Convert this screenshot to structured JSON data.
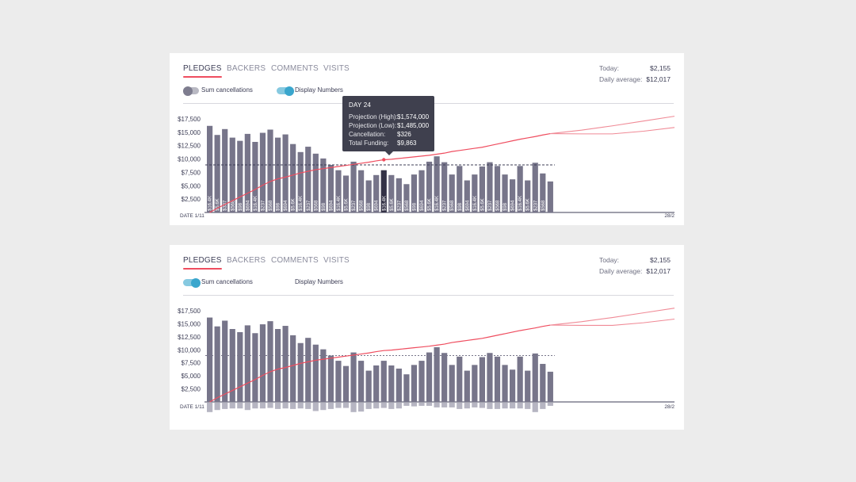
{
  "tabs": [
    "PLEDGES",
    "BACKERS",
    "COMMENTS",
    "VISITS"
  ],
  "stats": {
    "today_label": "Today:",
    "today_value": "$2,155",
    "avg_label": "Daily average:",
    "avg_value": "$12,017"
  },
  "toggles": {
    "sum_label": "Sum cancellations",
    "display_label": "Display Numbers"
  },
  "panel1": {
    "sum_cancellations_on": false,
    "display_numbers_on": true
  },
  "panel2": {
    "sum_cancellations_on": true,
    "display_numbers_on": false
  },
  "tooltip": {
    "title": "DAY 24",
    "rows": [
      {
        "label": "Projection (High):",
        "value": "$1,574,000"
      },
      {
        "label": "Projection (Low):",
        "value": "$1,485,000"
      },
      {
        "label": "Cancellation:",
        "value": "$326"
      },
      {
        "label": "Total Funding:",
        "value": "$9,863"
      }
    ]
  },
  "chart_data": {
    "type": "bar",
    "title": "",
    "xlabel_start": "DATE 1/11",
    "xlabel_end": "28/2",
    "ylim": [
      0,
      17500
    ],
    "yticks": [
      "$2,500",
      "$5,000",
      "$7,500",
      "$10,000",
      "$12,500",
      "$15,000",
      "$17,500"
    ],
    "ytick_values": [
      2500,
      5000,
      7500,
      10000,
      12500,
      15000,
      17500
    ],
    "average": 8900,
    "highlight_index": 23,
    "values": [
      16200,
      14500,
      15600,
      14000,
      13400,
      14700,
      13200,
      14900,
      15500,
      14000,
      14600,
      12800,
      11300,
      12300,
      11000,
      10100,
      8900,
      7900,
      6900,
      9500,
      7900,
      6000,
      7000,
      7900,
      7000,
      6400,
      5300,
      7100,
      7900,
      9500,
      10500,
      9400,
      7100,
      8700,
      6000,
      7100,
      8600,
      9400,
      8700,
      7100,
      6200,
      8700,
      6000,
      9300,
      7300,
      5800
    ],
    "cancellations": [
      1800,
      1400,
      1200,
      1100,
      1100,
      1400,
      1100,
      1100,
      1000,
      1200,
      1100,
      1200,
      1100,
      1200,
      1600,
      1400,
      1200,
      1000,
      1000,
      1800,
      1700,
      1200,
      1100,
      1000,
      1200,
      1100,
      600,
      700,
      600,
      600,
      900,
      900,
      900,
      1200,
      1100,
      900,
      1000,
      1200,
      1200,
      1100,
      1100,
      1100,
      1200,
      1800,
      1200,
      600
    ],
    "bar_labels": [
      "$16.4K",
      "$5.6K",
      "$337",
      "$568",
      "$98",
      "$694",
      "$16.4K",
      "$237",
      "$568",
      "$98",
      "$694",
      "$5.6K",
      "$16.4K",
      "$237",
      "$568",
      "$98",
      "$694",
      "$16.4K",
      "$5.6K",
      "$237",
      "$568",
      "$98",
      "$694",
      "$16.4K",
      "$5.6K",
      "$237",
      "$568",
      "$98",
      "$694",
      "$5.6K",
      "$16.4K",
      "$237",
      "$568",
      "$98",
      "$694",
      "$16.4K",
      "$5.6K",
      "$237",
      "$568",
      "$98",
      "$694",
      "$16.4K",
      "$5.6K",
      "$237",
      "$568"
    ],
    "series": [
      {
        "name": "Total Funding",
        "values": [
          0,
          800,
          1500,
          2200,
          2900,
          3600,
          4300,
          5100,
          5800,
          6300,
          6600,
          7000,
          7400,
          7700,
          8000,
          8200,
          8400,
          8600,
          8800,
          9000,
          9200,
          9400,
          9650,
          9863,
          9950,
          10100,
          10250,
          10400,
          10550,
          10700,
          10900,
          11100,
          11400,
          11600,
          11800,
          12000,
          12200,
          12500,
          12800,
          13100,
          13400,
          13700,
          13950,
          14200,
          14500,
          14750
        ]
      },
      {
        "name": "Projection (High)",
        "values": [
          14750,
          15400,
          16200,
          17100,
          18000
        ]
      },
      {
        "name": "Projection (Low)",
        "values": [
          14750,
          14700,
          14700,
          15200,
          15900
        ]
      }
    ]
  }
}
